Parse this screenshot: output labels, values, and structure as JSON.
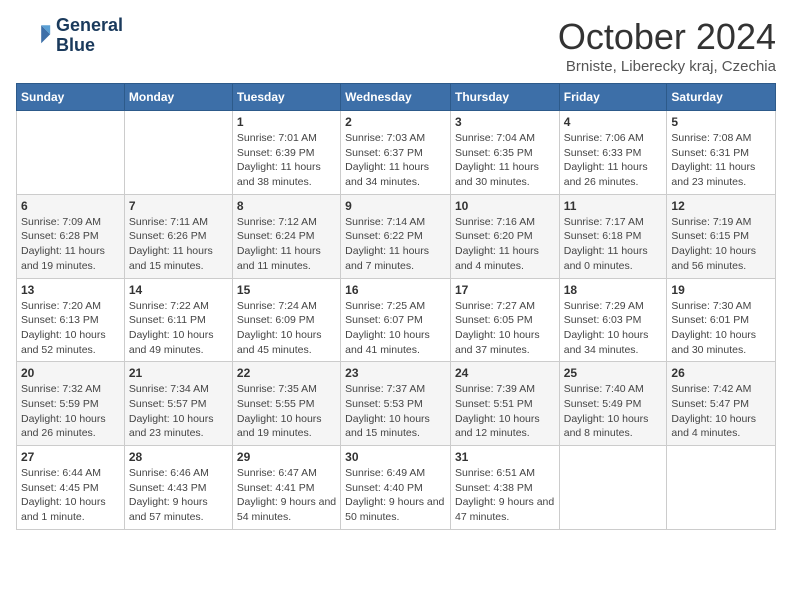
{
  "header": {
    "logo_line1": "General",
    "logo_line2": "Blue",
    "month_title": "October 2024",
    "subtitle": "Brniste, Liberecky kraj, Czechia"
  },
  "weekdays": [
    "Sunday",
    "Monday",
    "Tuesday",
    "Wednesday",
    "Thursday",
    "Friday",
    "Saturday"
  ],
  "weeks": [
    [
      {
        "day": "",
        "detail": ""
      },
      {
        "day": "",
        "detail": ""
      },
      {
        "day": "1",
        "detail": "Sunrise: 7:01 AM\nSunset: 6:39 PM\nDaylight: 11 hours and 38 minutes."
      },
      {
        "day": "2",
        "detail": "Sunrise: 7:03 AM\nSunset: 6:37 PM\nDaylight: 11 hours and 34 minutes."
      },
      {
        "day": "3",
        "detail": "Sunrise: 7:04 AM\nSunset: 6:35 PM\nDaylight: 11 hours and 30 minutes."
      },
      {
        "day": "4",
        "detail": "Sunrise: 7:06 AM\nSunset: 6:33 PM\nDaylight: 11 hours and 26 minutes."
      },
      {
        "day": "5",
        "detail": "Sunrise: 7:08 AM\nSunset: 6:31 PM\nDaylight: 11 hours and 23 minutes."
      }
    ],
    [
      {
        "day": "6",
        "detail": "Sunrise: 7:09 AM\nSunset: 6:28 PM\nDaylight: 11 hours and 19 minutes."
      },
      {
        "day": "7",
        "detail": "Sunrise: 7:11 AM\nSunset: 6:26 PM\nDaylight: 11 hours and 15 minutes."
      },
      {
        "day": "8",
        "detail": "Sunrise: 7:12 AM\nSunset: 6:24 PM\nDaylight: 11 hours and 11 minutes."
      },
      {
        "day": "9",
        "detail": "Sunrise: 7:14 AM\nSunset: 6:22 PM\nDaylight: 11 hours and 7 minutes."
      },
      {
        "day": "10",
        "detail": "Sunrise: 7:16 AM\nSunset: 6:20 PM\nDaylight: 11 hours and 4 minutes."
      },
      {
        "day": "11",
        "detail": "Sunrise: 7:17 AM\nSunset: 6:18 PM\nDaylight: 11 hours and 0 minutes."
      },
      {
        "day": "12",
        "detail": "Sunrise: 7:19 AM\nSunset: 6:15 PM\nDaylight: 10 hours and 56 minutes."
      }
    ],
    [
      {
        "day": "13",
        "detail": "Sunrise: 7:20 AM\nSunset: 6:13 PM\nDaylight: 10 hours and 52 minutes."
      },
      {
        "day": "14",
        "detail": "Sunrise: 7:22 AM\nSunset: 6:11 PM\nDaylight: 10 hours and 49 minutes."
      },
      {
        "day": "15",
        "detail": "Sunrise: 7:24 AM\nSunset: 6:09 PM\nDaylight: 10 hours and 45 minutes."
      },
      {
        "day": "16",
        "detail": "Sunrise: 7:25 AM\nSunset: 6:07 PM\nDaylight: 10 hours and 41 minutes."
      },
      {
        "day": "17",
        "detail": "Sunrise: 7:27 AM\nSunset: 6:05 PM\nDaylight: 10 hours and 37 minutes."
      },
      {
        "day": "18",
        "detail": "Sunrise: 7:29 AM\nSunset: 6:03 PM\nDaylight: 10 hours and 34 minutes."
      },
      {
        "day": "19",
        "detail": "Sunrise: 7:30 AM\nSunset: 6:01 PM\nDaylight: 10 hours and 30 minutes."
      }
    ],
    [
      {
        "day": "20",
        "detail": "Sunrise: 7:32 AM\nSunset: 5:59 PM\nDaylight: 10 hours and 26 minutes."
      },
      {
        "day": "21",
        "detail": "Sunrise: 7:34 AM\nSunset: 5:57 PM\nDaylight: 10 hours and 23 minutes."
      },
      {
        "day": "22",
        "detail": "Sunrise: 7:35 AM\nSunset: 5:55 PM\nDaylight: 10 hours and 19 minutes."
      },
      {
        "day": "23",
        "detail": "Sunrise: 7:37 AM\nSunset: 5:53 PM\nDaylight: 10 hours and 15 minutes."
      },
      {
        "day": "24",
        "detail": "Sunrise: 7:39 AM\nSunset: 5:51 PM\nDaylight: 10 hours and 12 minutes."
      },
      {
        "day": "25",
        "detail": "Sunrise: 7:40 AM\nSunset: 5:49 PM\nDaylight: 10 hours and 8 minutes."
      },
      {
        "day": "26",
        "detail": "Sunrise: 7:42 AM\nSunset: 5:47 PM\nDaylight: 10 hours and 4 minutes."
      }
    ],
    [
      {
        "day": "27",
        "detail": "Sunrise: 6:44 AM\nSunset: 4:45 PM\nDaylight: 10 hours and 1 minute."
      },
      {
        "day": "28",
        "detail": "Sunrise: 6:46 AM\nSunset: 4:43 PM\nDaylight: 9 hours and 57 minutes."
      },
      {
        "day": "29",
        "detail": "Sunrise: 6:47 AM\nSunset: 4:41 PM\nDaylight: 9 hours and 54 minutes."
      },
      {
        "day": "30",
        "detail": "Sunrise: 6:49 AM\nSunset: 4:40 PM\nDaylight: 9 hours and 50 minutes."
      },
      {
        "day": "31",
        "detail": "Sunrise: 6:51 AM\nSunset: 4:38 PM\nDaylight: 9 hours and 47 minutes."
      },
      {
        "day": "",
        "detail": ""
      },
      {
        "day": "",
        "detail": ""
      }
    ]
  ]
}
